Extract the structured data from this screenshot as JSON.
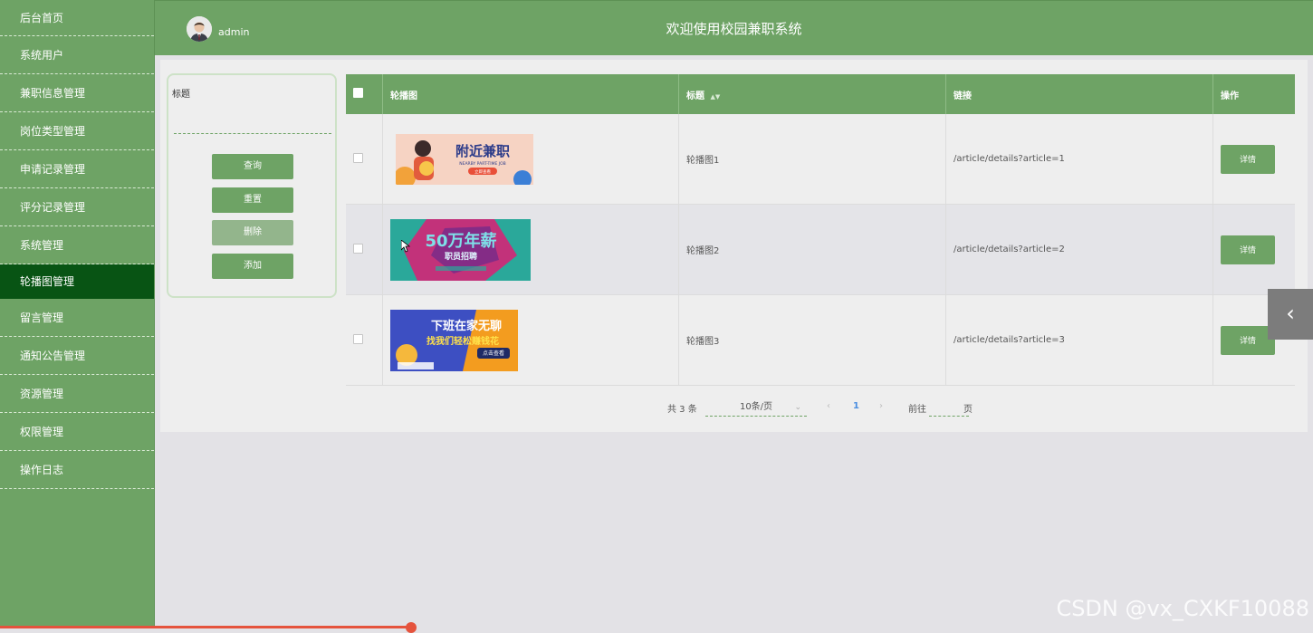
{
  "sidebar": {
    "items": [
      {
        "label": "后台首页"
      },
      {
        "label": "系统用户"
      },
      {
        "label": "兼职信息管理"
      },
      {
        "label": "岗位类型管理"
      },
      {
        "label": "申请记录管理"
      },
      {
        "label": "评分记录管理"
      },
      {
        "label": "系统管理"
      },
      {
        "label": "轮播图管理",
        "active": true
      },
      {
        "label": "留言管理"
      },
      {
        "label": "通知公告管理"
      },
      {
        "label": "资源管理"
      },
      {
        "label": "权限管理"
      },
      {
        "label": "操作日志"
      }
    ]
  },
  "header": {
    "username": "admin",
    "title": "欢迎使用校园兼职系统"
  },
  "search": {
    "label": "标题",
    "value": "",
    "buttons": {
      "query": "查询",
      "reset": "重置",
      "delete": "删除",
      "add": "添加"
    }
  },
  "table": {
    "headers": {
      "image": "轮播图",
      "title": "标题",
      "link": "链接",
      "action": "操作"
    },
    "sort_icon": "sort-arrows-icon",
    "rows": [
      {
        "title": "轮播图1",
        "link": "/article/details?article=1",
        "action": "详情",
        "banner": {
          "main": "附近兼职",
          "sub": "NEARBY PART-TIME JOB",
          "tag": "立即查看"
        }
      },
      {
        "title": "轮播图2",
        "link": "/article/details?article=2",
        "action": "详情",
        "banner": {
          "main": "50万年薪",
          "sub": "职员招聘"
        }
      },
      {
        "title": "轮播图3",
        "link": "/article/details?article=3",
        "action": "详情",
        "banner": {
          "main": "下班在家无聊",
          "sub": "找我们轻松赚钱花",
          "tag": "点击查看"
        }
      }
    ]
  },
  "pagination": {
    "total": "共 3 条",
    "page_size": "10条/页",
    "current_page": "1",
    "goto_label": "前往",
    "page_unit": "页"
  },
  "watermark": "CSDN @vx_CXKF10088",
  "colors": {
    "primary": "#6ea365",
    "active": "#085414",
    "disabled": "#93b58c"
  }
}
